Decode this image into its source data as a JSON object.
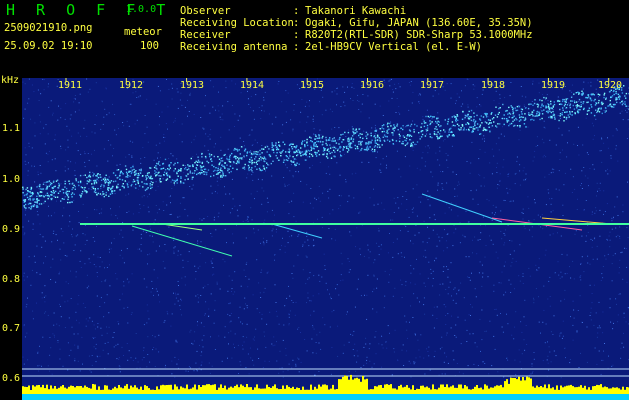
{
  "app": {
    "name": "H R O F F T",
    "version": "1.0.0"
  },
  "file": {
    "name": "2509021910.png",
    "datetime": "25.09.02 19:10",
    "mode": "meteor",
    "count": "100"
  },
  "info": [
    {
      "label": "Observer",
      "value": "Takanori Kawachi"
    },
    {
      "label": "Receiving Location",
      "value": "Ogaki, Gifu, JAPAN (136.60E, 35.35N)"
    },
    {
      "label": "Receiver",
      "value": "R820T2(RTL-SDR) SDR-Sharp 53.1000MHz"
    },
    {
      "label": "Receiving antenna",
      "value": "2el-HB9CV Vertical (el. E-W)"
    }
  ],
  "axes": {
    "y_unit": "kHz",
    "y_ticks": [
      "1.1",
      "1.0",
      "0.9",
      "0.8",
      "0.7",
      "0.6"
    ],
    "x_ticks": [
      "1911",
      "1912",
      "1913",
      "1914",
      "1915",
      "1916",
      "1917",
      "1918",
      "1919",
      "1920"
    ]
  },
  "colors": {
    "background": "#000000",
    "spectrogram_bg": "#0a1a7a",
    "header_text": "#ffff40",
    "logo": "#00e000",
    "carrier": "#40ffa0",
    "meteor_echo": "#40c0ff",
    "level_bar": "#ffff00",
    "level_base": "#00d0ff"
  }
}
